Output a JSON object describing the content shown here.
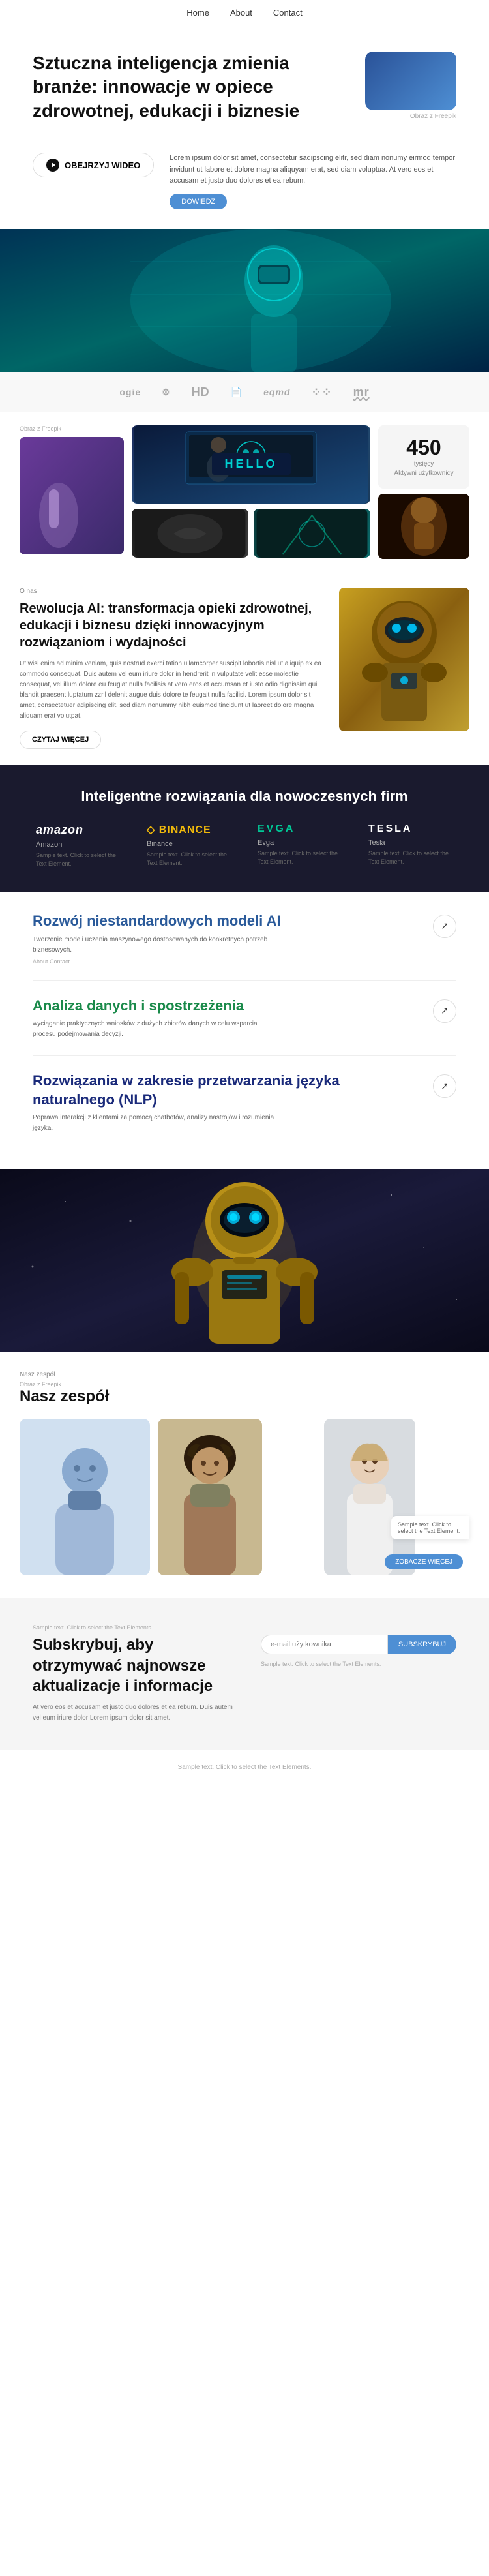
{
  "nav": {
    "items": [
      {
        "label": "Home",
        "active": true
      },
      {
        "label": "About",
        "active": false
      },
      {
        "label": "Contact",
        "active": false
      }
    ]
  },
  "hero": {
    "title": "Sztuczna inteligencja zmienia branże: innowacje w opiece zdrowotnej, edukacji i biznesie",
    "img_caption": "Obraz z Freepik",
    "btn_label": "OBEJRZYJ WIDEO",
    "body_text": "Lorem ipsum dolor sit amet, consectetur sadipscing elitr, sed diam nonumy eirmod tempor invidunt ut labore et dolore magna aliquyam erat, sed diam voluptua. At vero eos et accusam et justo duo dolores et ea rebum.",
    "dowiedz_label": "DOWIEDZ"
  },
  "logos": {
    "items": [
      {
        "label": "ogie",
        "style": "normal"
      },
      {
        "label": "⚙",
        "style": "icon"
      },
      {
        "label": "HD",
        "style": "bold"
      },
      {
        "label": "📋",
        "style": "icon"
      },
      {
        "label": "eqmd",
        "style": "italic"
      },
      {
        "label": "⁘⁘",
        "style": "dots"
      },
      {
        "label": "mr",
        "style": "logo"
      }
    ]
  },
  "gallery": {
    "caption": "Obraz z Freepik",
    "count": "450",
    "count_unit": "tysięcy",
    "count_sub": "Aktywni użytkownicy",
    "hello_text": "HELLO"
  },
  "about": {
    "label": "O nas",
    "title": "Rewolucja AI: transformacja opieki zdrowotnej, edukacji i biznesu dzięki innowacyjnym rozwiązaniom i wydajności",
    "body": "Ut wisi enim ad minim veniam, quis nostrud exerci tation ullamcorper suscipit lobortis nisl ut aliquip ex ea commodo consequat. Duis autem vel eum iriure dolor in hendrerit in vulputate velit esse molestie consequat, vel illum dolore eu feugiat nulla facilisis at vero eros et accumsan et iusto odio dignissim qui blandit praesent luptatum zzril delenit augue duis dolore te feugait nulla facilisi. Lorem ipsum dolor sit amet, consectetuer adipiscing elit, sed diam nonummy nibh euismod tincidunt ut laoreet dolore magna aliquam erat volutpat.",
    "btn_label": "CZYTAJ WIĘCEJ"
  },
  "dark_section": {
    "title": "Inteligentne rozwiązania dla nowoczesnych firm",
    "brands": [
      {
        "logo": "amazon",
        "name": "Amazon",
        "desc": "Sample text. Click to select the Text Element."
      },
      {
        "logo": "◇ BINANCE",
        "name": "Binance",
        "desc": "Sample text. Click to select the Text Element."
      },
      {
        "logo": "EVGA",
        "name": "Evga",
        "desc": "Sample text. Click to select the Text Element."
      },
      {
        "logo": "TESLA",
        "name": "Tesla",
        "desc": "Sample text. Click to select the Text Element."
      }
    ]
  },
  "services": {
    "items": [
      {
        "title": "Rozwój niestandardowych modeli AI",
        "desc": "Tworzenie modeli uczenia maszynowego dostosowanych do konkretnych potrzeb biznesowych.",
        "meta": "About  Contact",
        "color": "blue"
      },
      {
        "title": "Analiza danych i spostrzeżenia",
        "desc": "wyciąganie praktycznych wniosków z dużych zbiorów danych w celu wsparcia procesu podejmowania decyzji.",
        "meta": "",
        "color": "green"
      },
      {
        "title": "Rozwiązania w zakresie przetwarzania języka naturalnego (NLP)",
        "desc": "Poprawa interakcji z klientami za pomocą chatbotów, analizy nastrojów i rozumienia języka.",
        "meta": "",
        "color": "dark-blue"
      }
    ]
  },
  "team": {
    "label": "Nasz zespół",
    "caption": "Obraz z Freepik",
    "sample_text": "Sample text. Click to select the Text Element.",
    "btn_label": "ZOBACZE WIĘCEJ"
  },
  "subscribe": {
    "title": "Subskrybuj, aby otrzymywać najnowsze aktualizacje i informacje",
    "desc": "At vero eos et accusam et justo duo dolores et ea rebum. Duis autem vel eum iriure dolor Lorem ipsum dolor sit amet.",
    "sample_note": "Sample text. Click to select the Text Elements.",
    "input_placeholder": "e-mail użytkownika",
    "btn_label": "SUBSKRYBUJ"
  },
  "footer": {
    "text": "Sample text. Click to select the Text Elements."
  }
}
